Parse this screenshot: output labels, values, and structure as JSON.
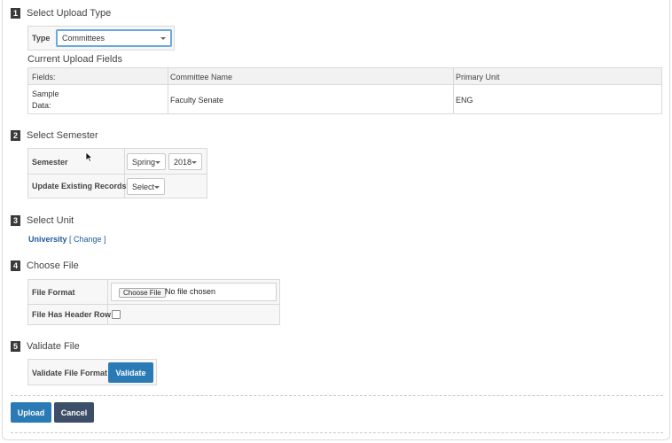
{
  "steps": [
    {
      "num": "1",
      "title": "Select Upload Type"
    },
    {
      "num": "2",
      "title": "Select Semester"
    },
    {
      "num": "3",
      "title": "Select Unit"
    },
    {
      "num": "4",
      "title": "Choose File"
    },
    {
      "num": "5",
      "title": "Validate File"
    }
  ],
  "upload_type": {
    "label": "Type",
    "value": "Committees"
  },
  "current_fields": {
    "title": "Current Upload Fields",
    "headers": [
      "Fields:",
      "Committee Name",
      "Primary Unit"
    ],
    "row_label_line1": "Sample",
    "row_label_line2": "Data:",
    "row_values": [
      "Faculty Senate",
      "ENG"
    ]
  },
  "semester": {
    "label": "Semester",
    "term_value": "Spring",
    "year_value": "2018",
    "update_label": "Update Existing Records*",
    "update_value": "Select"
  },
  "unit": {
    "name": "University",
    "change_label": "[ Change ]"
  },
  "file": {
    "format_label": "File Format",
    "choose_label": "Choose File",
    "no_file_text": "No file chosen",
    "header_row_label": "File Has Header Row",
    "header_row_checked": false
  },
  "validate": {
    "label": "Validate File Format",
    "button": "Validate"
  },
  "actions": {
    "upload": "Upload",
    "cancel": "Cancel"
  },
  "colors": {
    "primary": "#2a7ab5",
    "secondary": "#3d4f68",
    "link": "#1d5a9c"
  }
}
